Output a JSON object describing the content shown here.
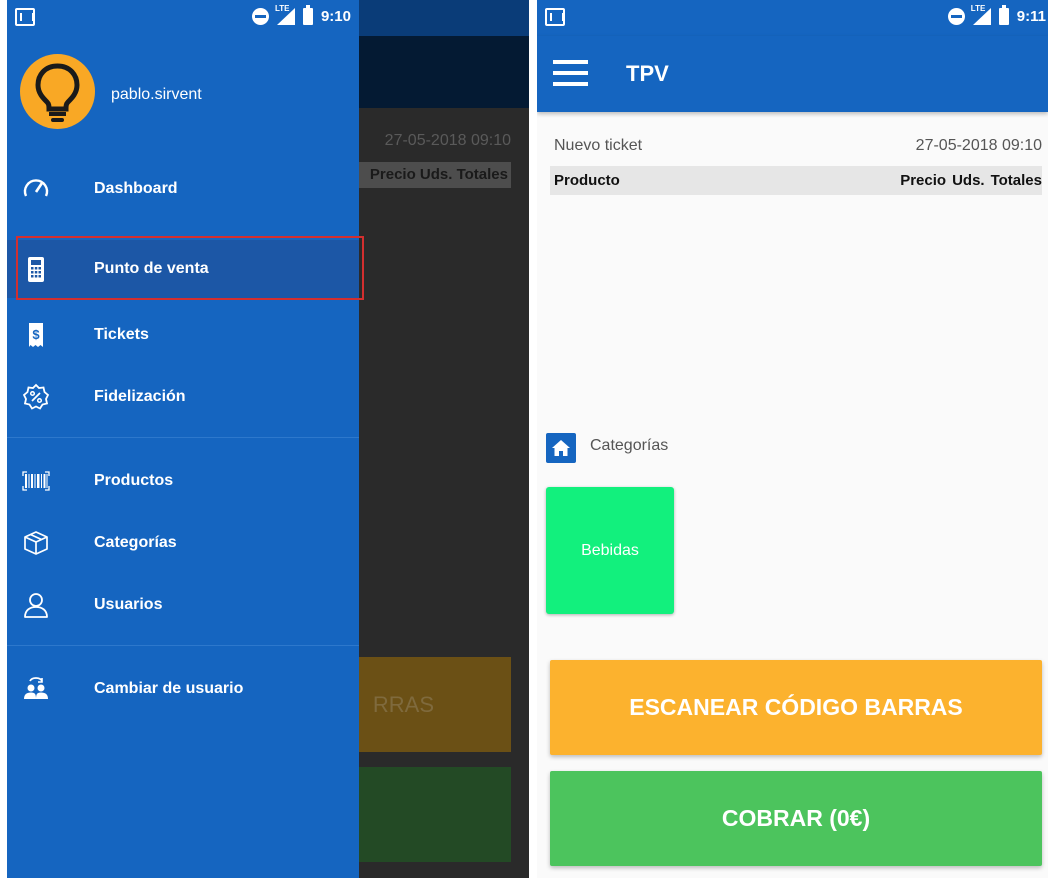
{
  "status_bar": {
    "left_time": "9:10",
    "right_time": "9:11",
    "network_label": "LTE"
  },
  "drawer": {
    "username": "pablo.sirvent",
    "items": [
      {
        "label": "Dashboard",
        "icon": "speedometer-icon"
      },
      {
        "label": "Punto de venta",
        "icon": "pos-terminal-icon",
        "active": true
      },
      {
        "label": "Tickets",
        "icon": "receipt-icon"
      },
      {
        "label": "Fidelización",
        "icon": "discount-badge-icon"
      },
      {
        "label": "Productos",
        "icon": "barcode-icon"
      },
      {
        "label": "Categorías",
        "icon": "box-icon"
      },
      {
        "label": "Usuarios",
        "icon": "user-icon"
      },
      {
        "label": "Cambiar de usuario",
        "icon": "switch-user-icon"
      }
    ]
  },
  "background": {
    "date": "27-05-2018 09:10",
    "header_cols": "Precio Uds. Totales",
    "scan_fragment": "RRAS"
  },
  "tpv": {
    "title": "TPV",
    "ticket_label": "Nuevo ticket",
    "ticket_date": "27-05-2018 09:10",
    "table_header": {
      "product": "Producto",
      "columns": [
        "Precio",
        "Uds.",
        "Totales"
      ]
    },
    "categories_label": "Categorías",
    "categories": [
      "Bebidas"
    ],
    "scan_button": "ESCANEAR CÓDIGO BARRAS",
    "pay_button": "COBRAR (0€)"
  },
  "colors": {
    "primary": "#1565c0",
    "scan": "#fcb22e",
    "pay": "#4cc45d",
    "category_tile": "#12f07d",
    "avatar": "#f9a825",
    "highlight": "#d32f2f"
  }
}
